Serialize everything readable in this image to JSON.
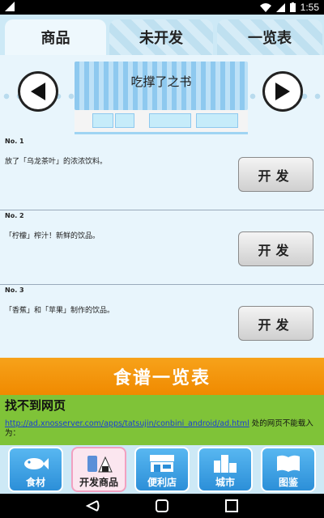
{
  "status_bar": {
    "time": "1:55"
  },
  "tabs": [
    {
      "label": "商品"
    },
    {
      "label": "未开发"
    },
    {
      "label": "一览表"
    }
  ],
  "store": {
    "title": "吃撑了之书"
  },
  "items": [
    {
      "number": "No. 1",
      "description": "放了「乌龙茶叶」的浓浓饮料。",
      "button": "开发"
    },
    {
      "number": "No. 2",
      "description": "「柠檬」榨汁！新鲜的饮品。",
      "button": "开发"
    },
    {
      "number": "No. 3",
      "description": "「香蕉」和「苹果」制作的饮品。",
      "button": "开发"
    }
  ],
  "recipe_button": {
    "label": "食谱一览表"
  },
  "ad": {
    "title": "找不到网页",
    "link": "http://ad.xnosserver.com/apps/tatsujin/conbini_android/ad.html",
    "message": " 处的网页不能载入为："
  },
  "bottom_nav": [
    {
      "label": "食材",
      "icon": "fish-icon"
    },
    {
      "label": "开发商品",
      "icon": "rice-ball-icon"
    },
    {
      "label": "便利店",
      "icon": "store-icon"
    },
    {
      "label": "城市",
      "icon": "city-icon"
    },
    {
      "label": "图鉴",
      "icon": "book-icon"
    }
  ],
  "colors": {
    "accent_blue": "#2c8fd8",
    "recipe_orange": "#f08a00",
    "ad_green": "#7fc338",
    "tab_bg": "#cde9f6"
  }
}
